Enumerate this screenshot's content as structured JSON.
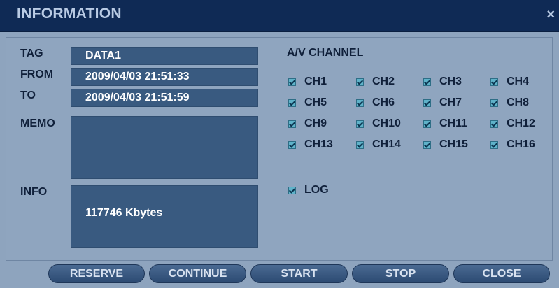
{
  "window": {
    "title": "INFORMATION",
    "close_icon": "×"
  },
  "labels": {
    "tag": "TAG",
    "from": "FROM",
    "to": "TO",
    "memo": "MEMO",
    "info": "INFO"
  },
  "fields": {
    "tag": "DATA1",
    "from": "2009/04/03 21:51:33",
    "to": "2009/04/03 21:51:59",
    "memo": "",
    "info": "117746 Kbytes"
  },
  "av_channel": {
    "heading": "A/V CHANNEL",
    "channels": [
      {
        "label": "CH1",
        "checked": true
      },
      {
        "label": "CH2",
        "checked": true
      },
      {
        "label": "CH3",
        "checked": true
      },
      {
        "label": "CH4",
        "checked": true
      },
      {
        "label": "CH5",
        "checked": true
      },
      {
        "label": "CH6",
        "checked": true
      },
      {
        "label": "CH7",
        "checked": true
      },
      {
        "label": "CH8",
        "checked": true
      },
      {
        "label": "CH9",
        "checked": true
      },
      {
        "label": "CH10",
        "checked": true
      },
      {
        "label": "CH11",
        "checked": true
      },
      {
        "label": "CH12",
        "checked": true
      },
      {
        "label": "CH13",
        "checked": true
      },
      {
        "label": "CH14",
        "checked": true
      },
      {
        "label": "CH15",
        "checked": true
      },
      {
        "label": "CH16",
        "checked": true
      }
    ],
    "log": {
      "label": "LOG",
      "checked": true
    }
  },
  "buttons": {
    "reserve": "RESERVE",
    "continue": "CONTINUE",
    "start": "START",
    "stop": "STOP",
    "close": "CLOSE"
  },
  "colors": {
    "titlebar": "#0f2a55",
    "panel": "#8fa5bf",
    "field": "#395a80",
    "checkbox": "#5fb2c9"
  }
}
